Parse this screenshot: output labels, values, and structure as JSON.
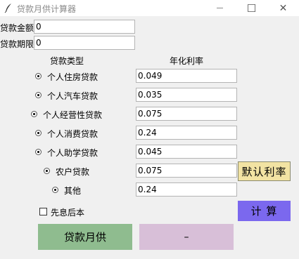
{
  "window": {
    "title": "贷款月供计算器",
    "min_glyph": "—",
    "max_glyph": "☐",
    "close_glyph": "✕"
  },
  "inputs": {
    "amount_label": "贷款金额",
    "amount_value": "0",
    "term_label": "贷款期限",
    "term_value": "0"
  },
  "headers": {
    "type": "贷款类型",
    "rate": "年化利率"
  },
  "loans": [
    {
      "label": "个人住房贷款",
      "rate": "0.049"
    },
    {
      "label": "个人汽车贷款",
      "rate": "0.035"
    },
    {
      "label": "个人经营性贷款",
      "rate": "0.075"
    },
    {
      "label": "个人消费贷款",
      "rate": "0.24"
    },
    {
      "label": "个人助学贷款",
      "rate": "0.045"
    },
    {
      "label": "农户贷款",
      "rate": "0.075"
    },
    {
      "label": "其他",
      "rate": "0.24"
    }
  ],
  "buttons": {
    "default_rate": "默认利率",
    "calculate": "计 算",
    "monthly_payment": "贷款月供",
    "result": "–"
  },
  "checkbox": {
    "label": "先息后本"
  },
  "colors": {
    "default_rate_bg": "#f2e3a3",
    "calculate_bg": "#7b68ee",
    "monthly_bg": "#8fbc8f",
    "result_bg": "#d8bfd8"
  }
}
